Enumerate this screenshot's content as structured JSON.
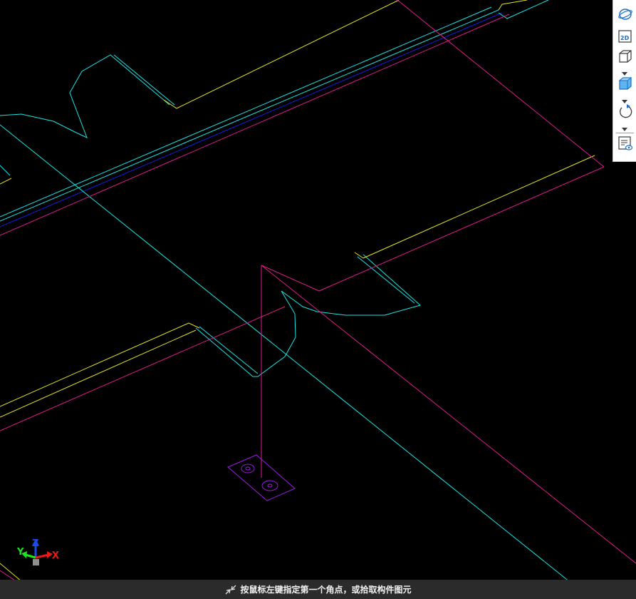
{
  "statusbar": {
    "prompt": "按鼠标左键指定第一个角点，或拾取构件图元",
    "icon": "cursor-select-icon"
  },
  "axis_triad": {
    "x": "X",
    "y": "Y",
    "z": "Z"
  },
  "toolbar": {
    "items": [
      {
        "name": "orbit-view",
        "icon": "orbit-icon"
      },
      {
        "name": "2d-view",
        "icon": "2d-icon",
        "label": "2D"
      },
      {
        "name": "view-cube",
        "icon": "cube-outline-icon"
      },
      {
        "name": "shaded-cube",
        "icon": "cube-shaded-icon"
      },
      {
        "name": "rotate",
        "icon": "rotate-icon"
      },
      {
        "name": "display-settings",
        "icon": "view-settings-icon"
      }
    ]
  },
  "colors": {
    "background": "#000000",
    "cyan": "#19e5e5",
    "yellow": "#e5e51a",
    "magenta": "#e01a8c",
    "blue": "#1a1ae5",
    "purple": "#9b1ae5",
    "axis_x": "#e51a1a",
    "axis_y": "#1ae51a",
    "axis_z": "#1a4ce5"
  }
}
